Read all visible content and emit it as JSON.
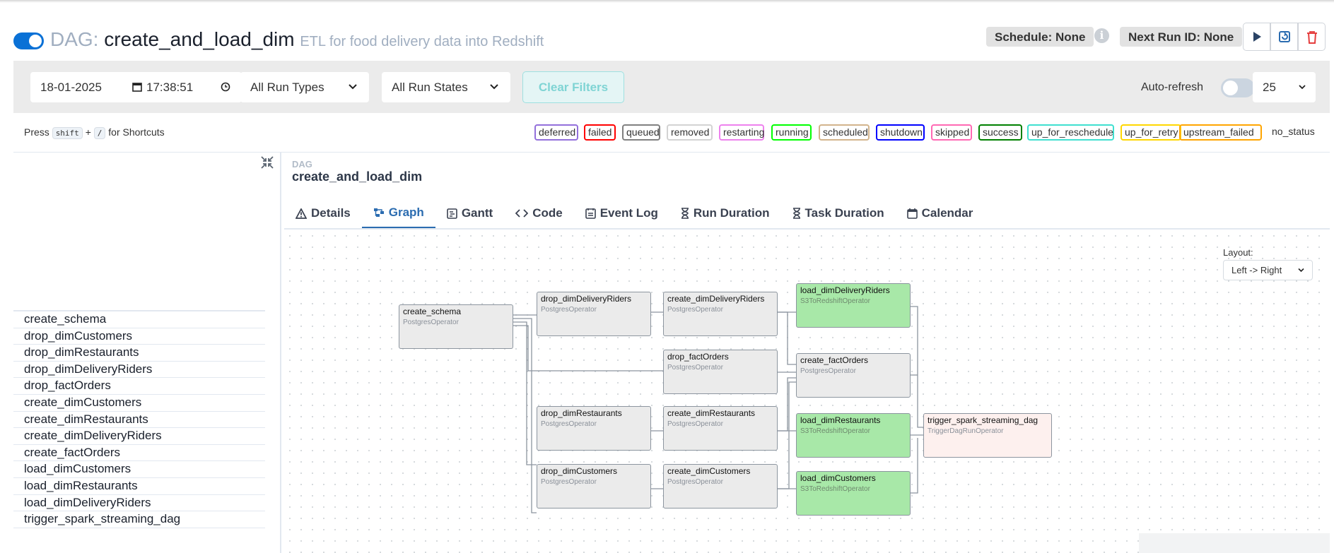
{
  "header": {
    "dag_label": "DAG:",
    "dag_id": "create_and_load_dim",
    "description": "ETL for food delivery data into Redshift",
    "schedule": "Schedule: None",
    "next_run": "Next Run ID: None",
    "info_glyph": "i",
    "actions": [
      "play-icon",
      "reparse-icon",
      "delete-icon"
    ]
  },
  "filters": {
    "date": "18-01-2025",
    "time": "17:38:51",
    "run_types": "All Run Types",
    "run_states": "All Run States",
    "clear_label": "Clear Filters",
    "auto_refresh_label": "Auto-refresh",
    "page_size": "25"
  },
  "shortcuts": {
    "press": "Press",
    "key1": "shift",
    "plus": "+",
    "key2": "/",
    "suffix": "for Shortcuts"
  },
  "legend": [
    {
      "label": "deferred",
      "color": "#9370db"
    },
    {
      "label": "failed",
      "color": "#ff0000"
    },
    {
      "label": "queued",
      "color": "#808080"
    },
    {
      "label": "removed",
      "color": "#d3d3d3"
    },
    {
      "label": "restarting",
      "color": "#ee82ee"
    },
    {
      "label": "running",
      "color": "#00ff00"
    },
    {
      "label": "scheduled",
      "color": "#d2b48c"
    },
    {
      "label": "shutdown",
      "color": "#0000ff"
    },
    {
      "label": "skipped",
      "color": "#ff69b4"
    },
    {
      "label": "success",
      "color": "#008000"
    },
    {
      "label": "up_for_reschedule",
      "color": "#40e0d0"
    },
    {
      "label": "up_for_retry",
      "color": "#ffd700"
    },
    {
      "label": "upstream_failed",
      "color": "#ffa500"
    }
  ],
  "no_status_label": "no_status",
  "tasks": [
    "create_schema",
    "drop_dimCustomers",
    "drop_dimRestaurants",
    "drop_dimDeliveryRiders",
    "drop_factOrders",
    "create_dimCustomers",
    "create_dimRestaurants",
    "create_dimDeliveryRiders",
    "create_factOrders",
    "load_dimCustomers",
    "load_dimRestaurants",
    "load_dimDeliveryRiders",
    "trigger_spark_streaming_dag"
  ],
  "panel": {
    "crumb_label": "DAG",
    "crumb_name": "create_and_load_dim",
    "tabs": [
      {
        "label": "Details",
        "icon": "warning-icon"
      },
      {
        "label": "Graph",
        "icon": "graph-icon"
      },
      {
        "label": "Gantt",
        "icon": "gantt-icon"
      },
      {
        "label": "Code",
        "icon": "code-icon"
      },
      {
        "label": "Event Log",
        "icon": "event-log-icon"
      },
      {
        "label": "Run Duration",
        "icon": "hourglass-icon"
      },
      {
        "label": "Task Duration",
        "icon": "hourglass-icon"
      },
      {
        "label": "Calendar",
        "icon": "calendar-icon"
      }
    ],
    "active_tab": "Graph",
    "layout_label": "Layout:",
    "layout_value": "Left -> Right"
  },
  "graph": {
    "nodes": [
      {
        "id": "create_schema",
        "op": "PostgresOperator",
        "state": "none"
      },
      {
        "id": "drop_dimDeliveryRiders",
        "op": "PostgresOperator",
        "state": "none"
      },
      {
        "id": "create_dimDeliveryRiders",
        "op": "PostgresOperator",
        "state": "none"
      },
      {
        "id": "load_dimDeliveryRiders",
        "op": "S3ToRedshiftOperator",
        "state": "success"
      },
      {
        "id": "drop_factOrders",
        "op": "PostgresOperator",
        "state": "none"
      },
      {
        "id": "create_factOrders",
        "op": "PostgresOperator",
        "state": "none"
      },
      {
        "id": "drop_dimRestaurants",
        "op": "PostgresOperator",
        "state": "none"
      },
      {
        "id": "create_dimRestaurants",
        "op": "PostgresOperator",
        "state": "none"
      },
      {
        "id": "load_dimRestaurants",
        "op": "S3ToRedshiftOperator",
        "state": "success"
      },
      {
        "id": "trigger_spark_streaming_dag",
        "op": "TriggerDagRunOperator",
        "state": "none"
      },
      {
        "id": "drop_dimCustomers",
        "op": "PostgresOperator",
        "state": "none"
      },
      {
        "id": "create_dimCustomers",
        "op": "PostgresOperator",
        "state": "none"
      },
      {
        "id": "load_dimCustomers",
        "op": "S3ToRedshiftOperator",
        "state": "success"
      }
    ]
  }
}
